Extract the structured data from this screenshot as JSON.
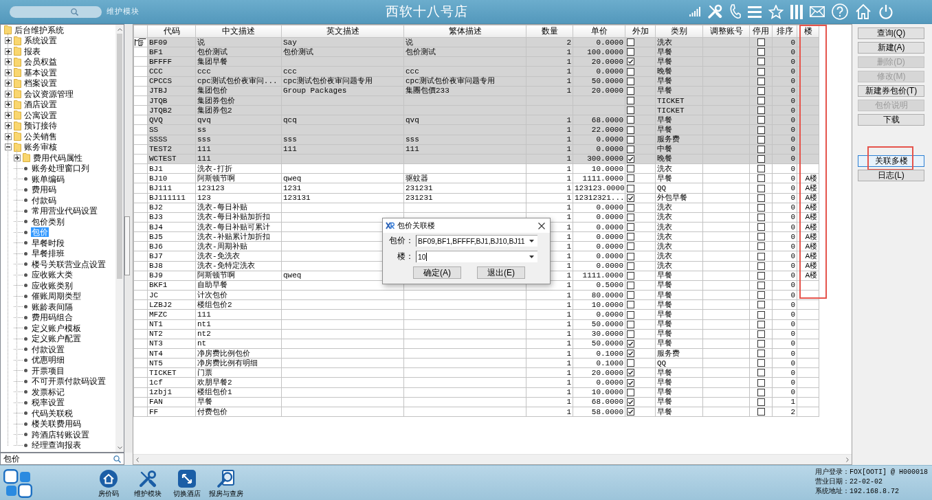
{
  "header": {
    "module": "维护模块",
    "title": "西软十八号店"
  },
  "tree": {
    "nodes": [
      {
        "label": "后台维护系统",
        "kind": "root",
        "selected": false,
        "children": [
          {
            "label": "系统设置",
            "kind": "folder",
            "expanded": false,
            "selected": false
          },
          {
            "label": "报表",
            "kind": "folder",
            "expanded": false,
            "selected": false
          },
          {
            "label": "会员权益",
            "kind": "folder",
            "expanded": false,
            "selected": false
          },
          {
            "label": "基本设置",
            "kind": "folder",
            "expanded": false,
            "selected": false
          },
          {
            "label": "档案设置",
            "kind": "folder",
            "expanded": false,
            "selected": false
          },
          {
            "label": "会议资源管理",
            "kind": "folder",
            "expanded": false,
            "selected": false
          },
          {
            "label": "酒店设置",
            "kind": "folder",
            "expanded": false,
            "selected": false
          },
          {
            "label": "公寓设置",
            "kind": "folder",
            "expanded": false,
            "selected": false
          },
          {
            "label": "预订接待",
            "kind": "folder",
            "expanded": false,
            "selected": false
          },
          {
            "label": "公关销售",
            "kind": "folder",
            "expanded": false,
            "selected": false
          },
          {
            "label": "账务审核",
            "kind": "folder",
            "expanded": true,
            "selected": false,
            "children": [
              {
                "label": "费用代码属性",
                "kind": "folder",
                "expanded": false,
                "selected": false
              },
              {
                "label": "账务处理窗口列",
                "kind": "leaf",
                "selected": false
              },
              {
                "label": "账单编码",
                "kind": "leaf",
                "selected": false
              },
              {
                "label": "费用码",
                "kind": "leaf",
                "selected": false
              },
              {
                "label": "付款码",
                "kind": "leaf",
                "selected": false
              },
              {
                "label": "常用营业代码设置",
                "kind": "leaf",
                "selected": false
              },
              {
                "label": "包价类别",
                "kind": "leaf",
                "selected": false
              },
              {
                "label": "包价",
                "kind": "leaf",
                "selected": true
              },
              {
                "label": "早餐时段",
                "kind": "leaf",
                "selected": false
              },
              {
                "label": "早餐排班",
                "kind": "leaf",
                "selected": false
              },
              {
                "label": "楼号关联营业点设置",
                "kind": "leaf",
                "selected": false
              },
              {
                "label": "应收账大类",
                "kind": "leaf",
                "selected": false
              },
              {
                "label": "应收账类别",
                "kind": "leaf",
                "selected": false
              },
              {
                "label": "催账周期类型",
                "kind": "leaf",
                "selected": false
              },
              {
                "label": "账龄表间隔",
                "kind": "leaf",
                "selected": false
              },
              {
                "label": "费用码组合",
                "kind": "leaf",
                "selected": false
              },
              {
                "label": "定义账户模板",
                "kind": "leaf",
                "selected": false
              },
              {
                "label": "定义账户配置",
                "kind": "leaf",
                "selected": false
              },
              {
                "label": "付款设置",
                "kind": "leaf",
                "selected": false
              },
              {
                "label": "优惠明细",
                "kind": "leaf",
                "selected": false
              },
              {
                "label": "开票项目",
                "kind": "leaf",
                "selected": false
              },
              {
                "label": "不可开票付款码设置",
                "kind": "leaf",
                "selected": false
              },
              {
                "label": "发票标记",
                "kind": "leaf",
                "selected": false
              },
              {
                "label": "税率设置",
                "kind": "leaf",
                "selected": false
              },
              {
                "label": "代码关联税",
                "kind": "leaf",
                "selected": false
              },
              {
                "label": "楼关联费用码",
                "kind": "leaf",
                "selected": false
              },
              {
                "label": "跨酒店转账设置",
                "kind": "leaf",
                "selected": false
              },
              {
                "label": "经理查询报表",
                "kind": "leaf",
                "selected": false
              }
            ]
          }
        ]
      }
    ],
    "search": {
      "value": "包价"
    }
  },
  "grid": {
    "columns": [
      {
        "label": "代码",
        "kind": "left",
        "highlighted": false
      },
      {
        "label": "中文描述",
        "kind": "left",
        "highlighted": false
      },
      {
        "label": "英文描述",
        "kind": "left",
        "highlighted": false
      },
      {
        "label": "繁体描述",
        "kind": "left",
        "highlighted": false
      },
      {
        "label": "数量",
        "kind": "right",
        "highlighted": false
      },
      {
        "label": "单价",
        "kind": "right",
        "highlighted": false
      },
      {
        "label": "外加",
        "kind": "check",
        "highlighted": false
      },
      {
        "label": "类别",
        "kind": "left",
        "highlighted": false
      },
      {
        "label": "调整账号",
        "kind": "left",
        "highlighted": false
      },
      {
        "label": "停用",
        "kind": "check",
        "highlighted": false
      },
      {
        "label": "排序",
        "kind": "right",
        "highlighted": false
      },
      {
        "label": "楼",
        "kind": "right",
        "highlighted": true
      }
    ],
    "rows": [
      {
        "code": "BF09",
        "zh": "说",
        "en": "Say",
        "tw": "说",
        "qty": "2",
        "price": "0.0000",
        "extra": false,
        "category": "洗衣",
        "inactive": false,
        "order": "0",
        "selected": true,
        "current": true
      },
      {
        "code": "BF1",
        "zh": "包价测试",
        "en": "包价测试",
        "tw": "包价测试",
        "qty": "1",
        "price": "100.0000",
        "extra": false,
        "category": "早餐",
        "inactive": false,
        "order": "0",
        "selected": true,
        "current": false
      },
      {
        "code": "BFFFF",
        "zh": "集团早餐",
        "qty": "1",
        "price": "20.0000",
        "extra": true,
        "category": "早餐",
        "inactive": false,
        "order": "0",
        "selected": true,
        "current": false
      },
      {
        "code": "CCC",
        "zh": "ccc",
        "en": "ccc",
        "tw": "ccc",
        "qty": "1",
        "price": "0.0000",
        "extra": false,
        "category": "晚餐",
        "inactive": false,
        "order": "0",
        "selected": true,
        "current": false
      },
      {
        "code": "CPCCS",
        "zh": "cpc测试包价夜审问...",
        "en": "cpc测试包价夜审问题专用",
        "tw": "cpc测试包价夜审问题专用",
        "qty": "1",
        "price": "50.0000",
        "extra": false,
        "category": "早餐",
        "inactive": false,
        "order": "0",
        "selected": true,
        "current": false
      },
      {
        "code": "JTBJ",
        "zh": "集团包价",
        "en": "Group Packages",
        "tw": "集團包價233",
        "qty": "1",
        "price": "20.0000",
        "extra": false,
        "category": "早餐",
        "inactive": false,
        "order": "0",
        "selected": true,
        "current": false
      },
      {
        "code": "JTQB",
        "zh": "集团券包价",
        "extra": false,
        "category": "TICKET",
        "inactive": false,
        "order": "0",
        "selected": true,
        "current": false
      },
      {
        "code": "JTQB2",
        "zh": "集团券包2",
        "extra": false,
        "category": "TICKET",
        "inactive": false,
        "order": "0",
        "selected": true,
        "current": false
      },
      {
        "code": "QVQ",
        "zh": "qvq",
        "en": "qcq",
        "tw": "qvq",
        "qty": "1",
        "price": "68.0000",
        "extra": false,
        "category": "早餐",
        "inactive": false,
        "order": "0",
        "selected": true,
        "current": false
      },
      {
        "code": "SS",
        "zh": "ss",
        "qty": "1",
        "price": "22.0000",
        "extra": false,
        "category": "早餐",
        "inactive": false,
        "order": "0",
        "selected": true,
        "current": false
      },
      {
        "code": "SSSS",
        "zh": "sss",
        "en": "sss",
        "tw": "sss",
        "qty": "1",
        "price": "0.0000",
        "extra": false,
        "category": "服务费",
        "inactive": false,
        "order": "0",
        "selected": true,
        "current": false
      },
      {
        "code": "TEST2",
        "zh": "111",
        "en": "111",
        "tw": "111",
        "qty": "1",
        "price": "0.0000",
        "extra": false,
        "category": "中餐",
        "inactive": false,
        "order": "0",
        "selected": true,
        "current": false
      },
      {
        "code": "WCTEST",
        "zh": "111",
        "qty": "1",
        "price": "300.0000",
        "extra": true,
        "category": "晚餐",
        "inactive": false,
        "order": "0",
        "selected": true,
        "current": false
      },
      {
        "code": "BJ1",
        "zh": "洗衣-打折",
        "qty": "1",
        "price": "10.0000",
        "extra": false,
        "category": "洗衣",
        "inactive": false,
        "order": "0",
        "selected": false,
        "current": false
      },
      {
        "code": "BJ10",
        "zh": "阿斯顿节啊",
        "en": "qweq",
        "tw": "驱蚊器",
        "qty": "1",
        "price": "1111.0000",
        "extra": false,
        "category": "早餐",
        "inactive": false,
        "order": "0",
        "floor": "A楼",
        "selected": false,
        "current": false
      },
      {
        "code": "BJ111",
        "zh": "123123",
        "en": "1231",
        "tw": "231231",
        "qty": "1",
        "price": "123123.0000",
        "extra": false,
        "category": "QQ",
        "inactive": false,
        "order": "0",
        "floor": "A楼",
        "selected": false,
        "current": false
      },
      {
        "code": "BJ111111",
        "zh": "123",
        "en": "123131",
        "tw": "231231",
        "qty": "1",
        "price": "12312321...",
        "extra": true,
        "category": "外包早餐",
        "inactive": false,
        "order": "0",
        "floor": "A楼",
        "selected": false,
        "current": false
      },
      {
        "code": "BJ2",
        "zh": "洗衣-每日补贴",
        "qty": "1",
        "price": "0.0000",
        "extra": false,
        "category": "洗衣",
        "inactive": false,
        "order": "0",
        "floor": "A楼",
        "selected": false,
        "current": false
      },
      {
        "code": "BJ3",
        "zh": "洗衣-每日补贴加折扣",
        "qty": "1",
        "price": "0.0000",
        "extra": false,
        "category": "洗衣",
        "inactive": false,
        "order": "0",
        "floor": "A楼",
        "selected": false,
        "current": false
      },
      {
        "code": "BJ4",
        "zh": "洗衣-每日补贴可累计",
        "qty": "1",
        "price": "0.0000",
        "extra": false,
        "category": "洗衣",
        "inactive": false,
        "order": "0",
        "floor": "A楼",
        "selected": false,
        "current": false
      },
      {
        "code": "BJ5",
        "zh": "洗衣-补贴累计加折扣",
        "qty": "1",
        "price": "0.0000",
        "extra": false,
        "category": "洗衣",
        "inactive": false,
        "order": "0",
        "floor": "A楼",
        "selected": false,
        "current": false
      },
      {
        "code": "BJ6",
        "zh": "洗衣-周期补贴",
        "qty": "1",
        "price": "0.0000",
        "extra": false,
        "category": "洗衣",
        "inactive": false,
        "order": "0",
        "floor": "A楼",
        "selected": false,
        "current": false
      },
      {
        "code": "BJ7",
        "zh": "洗衣-免洗衣",
        "qty": "1",
        "price": "0.0000",
        "extra": false,
        "category": "洗衣",
        "inactive": false,
        "order": "0",
        "floor": "A楼",
        "selected": false,
        "current": false
      },
      {
        "code": "BJ8",
        "zh": "洗衣-免特定洗衣",
        "qty": "1",
        "price": "0.0000",
        "extra": false,
        "category": "洗衣",
        "inactive": false,
        "order": "0",
        "floor": "A楼",
        "selected": false,
        "current": false
      },
      {
        "code": "BJ9",
        "zh": "阿斯顿节啊",
        "en": "qweq",
        "qty": "1",
        "price": "1111.0000",
        "extra": false,
        "category": "早餐",
        "inactive": false,
        "order": "0",
        "floor": "A楼",
        "selected": false,
        "current": false
      },
      {
        "code": "BKF1",
        "zh": "自助早餐",
        "qty": "1",
        "price": "0.5000",
        "extra": false,
        "category": "早餐",
        "inactive": false,
        "order": "0",
        "selected": false,
        "current": false
      },
      {
        "code": "JC",
        "zh": "计次包价",
        "qty": "1",
        "price": "80.0000",
        "extra": false,
        "category": "早餐",
        "inactive": false,
        "order": "0",
        "selected": false,
        "current": false
      },
      {
        "code": "LZBJ2",
        "zh": "楼组包价2",
        "qty": "1",
        "price": "10.0000",
        "extra": false,
        "category": "早餐",
        "inactive": false,
        "order": "0",
        "selected": false,
        "current": false
      },
      {
        "code": "MFZC",
        "zh": "111",
        "qty": "1",
        "price": "0.0000",
        "extra": false,
        "category": "早餐",
        "inactive": false,
        "order": "0",
        "selected": false,
        "current": false
      },
      {
        "code": "NT1",
        "zh": "nt1",
        "qty": "1",
        "price": "50.0000",
        "extra": false,
        "category": "早餐",
        "inactive": false,
        "order": "0",
        "selected": false,
        "current": false
      },
      {
        "code": "NT2",
        "zh": "nt2",
        "qty": "1",
        "price": "30.0000",
        "extra": false,
        "category": "早餐",
        "inactive": false,
        "order": "0",
        "selected": false,
        "current": false
      },
      {
        "code": "NT3",
        "zh": "nt",
        "qty": "1",
        "price": "50.0000",
        "extra": true,
        "category": "早餐",
        "inactive": false,
        "order": "0",
        "selected": false,
        "current": false
      },
      {
        "code": "NT4",
        "zh": "净房费比例包价",
        "qty": "1",
        "price": "0.1000",
        "extra": true,
        "category": "服务费",
        "inactive": false,
        "order": "0",
        "selected": false,
        "current": false
      },
      {
        "code": "NT5",
        "zh": "净房费比例有明细",
        "qty": "1",
        "price": "0.1000",
        "extra": false,
        "category": "QQ",
        "inactive": false,
        "order": "0",
        "selected": false,
        "current": false
      },
      {
        "code": "TICKET",
        "zh": "门票",
        "qty": "1",
        "price": "20.0000",
        "extra": true,
        "category": "早餐",
        "inactive": false,
        "order": "0",
        "selected": false,
        "current": false
      },
      {
        "code": "1cf",
        "zh": "欢朋早餐2",
        "qty": "1",
        "price": "0.0000",
        "extra": true,
        "category": "早餐",
        "inactive": false,
        "order": "0",
        "selected": false,
        "current": false
      },
      {
        "code": "1zbj1",
        "zh": "楼组包价1",
        "qty": "1",
        "price": "10.0000",
        "extra": false,
        "category": "早餐",
        "inactive": false,
        "order": "0",
        "selected": false,
        "current": false
      },
      {
        "code": "FAN",
        "zh": "早餐",
        "qty": "1",
        "price": "68.0000",
        "extra": true,
        "category": "早餐",
        "inactive": false,
        "order": "1",
        "selected": false,
        "current": false
      },
      {
        "code": "FF",
        "zh": "付费包价",
        "qty": "1",
        "price": "58.0000",
        "extra": true,
        "category": "早餐",
        "inactive": false,
        "order": "2",
        "selected": false,
        "current": false
      }
    ]
  },
  "actions": {
    "buttons": [
      {
        "label": "查询(Q)",
        "disabled": false
      },
      {
        "label": "新建(A)",
        "disabled": false
      },
      {
        "label": "删除(D)",
        "disabled": true
      },
      {
        "label": "修改(M)",
        "disabled": true
      },
      {
        "label": "新建券包价(T)",
        "disabled": false
      },
      {
        "label": "包价说明",
        "disabled": true
      },
      {
        "label": "下载",
        "disabled": false
      }
    ],
    "lower_buttons": [
      {
        "label": "关联多楼",
        "focused": true,
        "highlighted": true
      },
      {
        "label": "日志(L)",
        "focused": false,
        "highlighted": false
      }
    ]
  },
  "dialog": {
    "title": "包价关联楼",
    "fields": [
      {
        "label": "包价：",
        "value": "BF09,BF1,BFFFF,BJ1,BJ10,BJ11",
        "focused": false
      },
      {
        "label": "楼：",
        "value": "10",
        "focused": true
      }
    ],
    "buttons": [
      {
        "label": "确定(A)"
      },
      {
        "label": "退出(E)"
      }
    ]
  },
  "taskbar": {
    "items": [
      {
        "label": "房价码"
      },
      {
        "label": "维护模块"
      },
      {
        "label": "切换酒店"
      },
      {
        "label": "报房与查房"
      }
    ],
    "status": [
      "用户登录：FOX[OOTI] @ H000018",
      "营业日期：22-02-02",
      "系统地址：192.168.8.72"
    ]
  }
}
